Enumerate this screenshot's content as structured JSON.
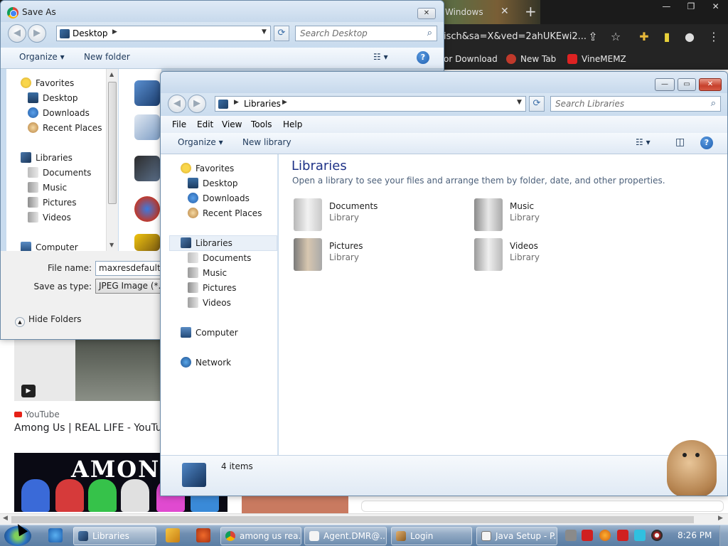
{
  "browser": {
    "tab_title": "Windows",
    "url_fragment": "isch&sa=X&ved=2ahUKEwi2...",
    "bookmarks": [
      "or Download",
      "New Tab",
      "VineMEMZ"
    ],
    "yt_source": "YouTube",
    "yt_title": "Among Us | REAL LIFE - YouTube",
    "image_logo_text": "AMONG U"
  },
  "saveas": {
    "title": "Save As",
    "address": "Desktop",
    "search_placeholder": "Search Desktop",
    "organize": "Organize",
    "new_folder": "New folder",
    "favorites": "Favorites",
    "nav": [
      "Desktop",
      "Downloads",
      "Recent Places"
    ],
    "libraries": "Libraries",
    "lib_nav": [
      "Documents",
      "Music",
      "Pictures",
      "Videos"
    ],
    "computer": "Computer",
    "file_name_label": "File name:",
    "file_name_value": "maxresdefault.jp",
    "save_type_label": "Save as type:",
    "save_type_value": "JPEG Image (*.jp",
    "hide_folders": "Hide Folders"
  },
  "libwin": {
    "address": "Libraries",
    "search_placeholder": "Search Libraries",
    "menu": [
      "File",
      "Edit",
      "View",
      "Tools",
      "Help"
    ],
    "organize": "Organize",
    "new_library": "New library",
    "favorites": "Favorites",
    "fav_items": [
      "Desktop",
      "Downloads",
      "Recent Places"
    ],
    "libraries": "Libraries",
    "lib_items": [
      "Documents",
      "Music",
      "Pictures",
      "Videos"
    ],
    "computer": "Computer",
    "network": "Network",
    "heading": "Libraries",
    "subheading": "Open a library to see your files and arrange them by folder, date, and other properties.",
    "tiles": [
      {
        "name": "Documents",
        "kind": "Library"
      },
      {
        "name": "Music",
        "kind": "Library"
      },
      {
        "name": "Pictures",
        "kind": "Library"
      },
      {
        "name": "Videos",
        "kind": "Library"
      }
    ],
    "item_count": "4 items"
  },
  "taskbar": {
    "items": [
      "Libraries",
      "among us rea...",
      "Agent.DMR@...",
      "Login",
      "Java Setup - P..."
    ],
    "clock": "8:26 PM"
  }
}
